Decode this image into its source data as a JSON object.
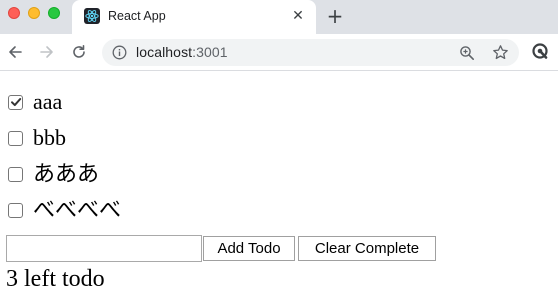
{
  "browser": {
    "tab": {
      "title": "React App",
      "favicon": "react-logo-icon",
      "close_glyph": "✕"
    },
    "new_tab_glyph": "+",
    "omnibox": {
      "host": "localhost",
      "port": ":3001"
    },
    "icons": {
      "back": "arrow-left-icon",
      "forward": "arrow-right-icon",
      "reload": "reload-icon",
      "info": "info-icon",
      "zoom": "zoom-icon",
      "bookmark": "star-icon",
      "extension": "extension-icon"
    },
    "colors": {
      "tabstrip": "#dee1e6",
      "omnibox": "#f1f3f4",
      "close": "#fe5f57",
      "minimize": "#febc2e",
      "maximize": "#28c840"
    }
  },
  "todos": [
    {
      "text": "aaa",
      "checked": true
    },
    {
      "text": "bbb",
      "checked": false
    },
    {
      "text": "あああ",
      "checked": false
    },
    {
      "text": "べべべべ",
      "checked": false
    }
  ],
  "form": {
    "input_value": "",
    "add_label": "Add Todo",
    "clear_label": "Clear Complete"
  },
  "summary": {
    "left_text": "3 left todo"
  }
}
